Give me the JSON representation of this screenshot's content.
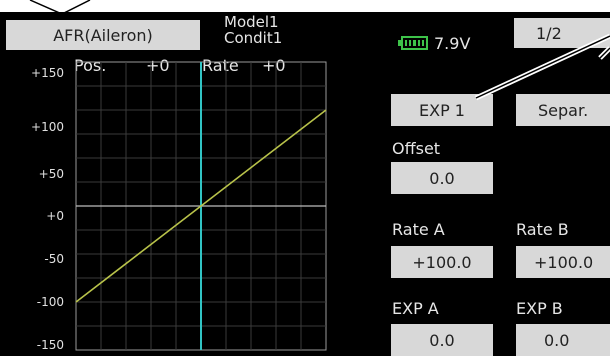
{
  "header": {
    "function_title": "AFR(Aileron)",
    "model_name": "Model1",
    "condition_name": "Condit1",
    "battery_voltage": "7.9V",
    "battery_icon": "battery-icon",
    "page_indicator": "1/2"
  },
  "graph": {
    "pos_label": "Pos.",
    "pos_value": "+0",
    "rate_label": "Rate",
    "rate_value": "+0",
    "y_ticks": [
      "+150",
      "+100",
      "+50",
      "+0",
      "-50",
      "-100",
      "-150"
    ],
    "curve_color": "#b8c24a",
    "cursor_color": "#31c4c4"
  },
  "controls": {
    "exp_button": "EXP 1",
    "separ_button": "Separ.",
    "offset_label": "Offset",
    "offset_value": "0.0",
    "rate_a_label": "Rate A",
    "rate_a_value": "+100.0",
    "rate_b_label": "Rate B",
    "rate_b_value": "+100.0",
    "exp_a_label": "EXP A",
    "exp_a_value": "0.0",
    "exp_b_label": "EXP B",
    "exp_b_value": "0.0"
  },
  "chart_data": {
    "type": "line",
    "ylim": [
      -150,
      150
    ],
    "xlim": [
      -100,
      100
    ],
    "series": [
      {
        "x": [
          -100,
          100
        ],
        "y": [
          -100,
          100
        ]
      }
    ]
  }
}
